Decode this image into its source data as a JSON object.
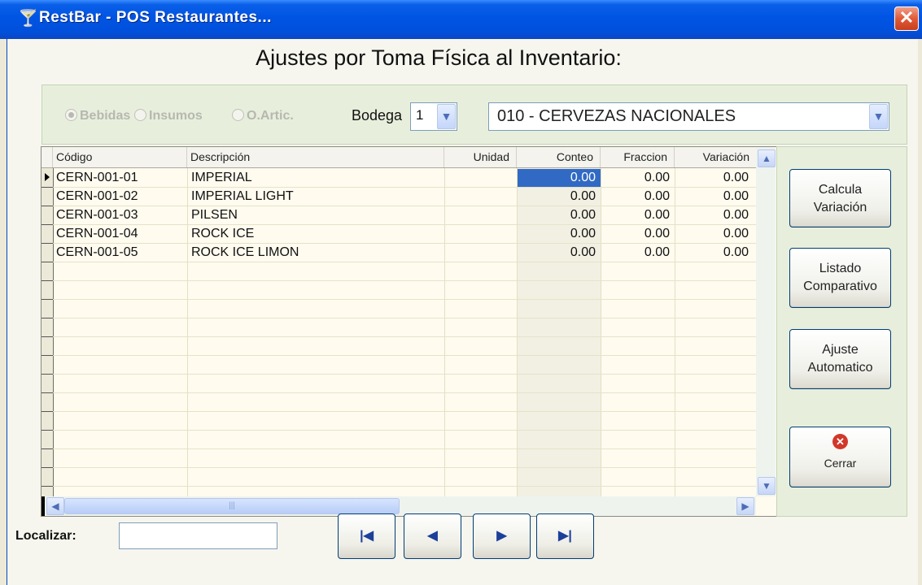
{
  "window": {
    "title": "RestBar - POS Restaurantes...",
    "close_symbol": "✕"
  },
  "page": {
    "title": "Ajustes por Toma Física al Inventario:"
  },
  "filters": {
    "radios": [
      {
        "label": "Bebidas",
        "selected": true,
        "enabled": false
      },
      {
        "label": "Insumos",
        "selected": false,
        "enabled": false
      },
      {
        "label": "O.Artic.",
        "selected": false,
        "enabled": false
      }
    ],
    "bodega_label": "Bodega",
    "bodega_value": "1",
    "category_value": "010 - CERVEZAS NACIONALES"
  },
  "grid": {
    "columns": [
      "Código",
      "Descripción",
      "Unidad",
      "Conteo",
      "Fraccion",
      "Variación"
    ],
    "rows": [
      {
        "codigo": "CERN-001-01",
        "descripcion": "IMPERIAL",
        "unidad": "",
        "conteo": "0.00",
        "fraccion": "0.00",
        "variacion": "0.00"
      },
      {
        "codigo": "CERN-001-02",
        "descripcion": "IMPERIAL LIGHT",
        "unidad": "",
        "conteo": "0.00",
        "fraccion": "0.00",
        "variacion": "0.00"
      },
      {
        "codigo": "CERN-001-03",
        "descripcion": "PILSEN",
        "unidad": "",
        "conteo": "0.00",
        "fraccion": "0.00",
        "variacion": "0.00"
      },
      {
        "codigo": "CERN-001-04",
        "descripcion": "ROCK ICE",
        "unidad": "",
        "conteo": "0.00",
        "fraccion": "0.00",
        "variacion": "0.00"
      },
      {
        "codigo": "CERN-001-05",
        "descripcion": "ROCK ICE LIMON",
        "unidad": "",
        "conteo": "0.00",
        "fraccion": "0.00",
        "variacion": "0.00"
      }
    ],
    "selected_row": 0,
    "selected_column": "conteo"
  },
  "actions": {
    "calcula": [
      "Calcula",
      "Variación"
    ],
    "listado": [
      "Listado",
      "Comparativo"
    ],
    "ajuste": [
      "Ajuste",
      "Automatico"
    ],
    "cerrar": "Cerrar"
  },
  "footer": {
    "localizar_label": "Localizar:",
    "localizar_value": ""
  },
  "icons": {
    "app": "martini-glass-icon",
    "first": "first-record-icon",
    "prev": "previous-record-icon",
    "next": "next-record-icon",
    "last": "last-record-icon",
    "cerrar": "close-circle-icon"
  },
  "colors": {
    "titlebar": "#0054e3",
    "selection": "#316ac5",
    "panel": "#e7efdc"
  }
}
